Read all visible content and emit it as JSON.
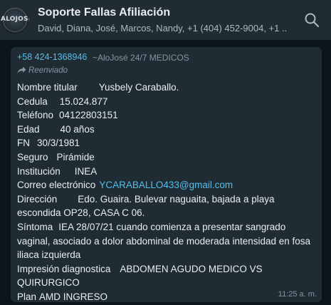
{
  "header": {
    "avatar_text": "ALOJOSÉ",
    "title": "Soporte Fallas Afiliación",
    "members": "David, Diana, José, Marcos, Nandy, +1 (404) 452-9004, +1 ...",
    "search_icon": "search-icon"
  },
  "message": {
    "sender_phone": "+58 424-1368946",
    "sender_name": "~AloJosé 24/7 MEDICOS",
    "forwarded_label": "Reenviado",
    "forwarded_icon": "forward-arrow-icon",
    "lines": {
      "nombre_label": "Nombre titular",
      "nombre_value": "Yusbely Caraballo.",
      "cedula_label": "Cedula",
      "cedula_value": "15.024.877",
      "telefono_label": "Teléfono",
      "telefono_value": "04122803151",
      "edad_label": "Edad",
      "edad_value": "40 años",
      "fn_label": "FN",
      "fn_value": "30/3/1981",
      "seguro_label": "Seguro",
      "seguro_value": "Pirámide",
      "institucion_label": "Institución",
      "institucion_value": "INEA",
      "correo_label": "Correo electrónico",
      "correo_value": "YCARABALLO433@gmail.com",
      "direccion_label": "Dirección",
      "direccion_value": "Edo. Guaira. Bulevar naguaita, bajada a playa escondida OP28, CASA C 06.",
      "sintoma_label": "Síntoma",
      "sintoma_value": "IEA 28/07/21 cuando comienza a presentar sangrado vaginal, asociado a dolor abdominal de moderada intensidad en fosa iliaca izquierda",
      "impresion_label": "Impresión diagnostica",
      "impresion_value": "ABDOMEN AGUDO MEDICO VS QUIRURGICO",
      "plan_label": "Plan",
      "plan_value": "AMD INGRESO"
    },
    "timestamp": "11:25 a. m."
  },
  "colors": {
    "header_bg": "#202c33",
    "chat_bg": "#0b141a",
    "bubble_bg": "#202c33",
    "link": "#53bdeb",
    "muted": "#8696a0",
    "text": "#e9edef"
  }
}
